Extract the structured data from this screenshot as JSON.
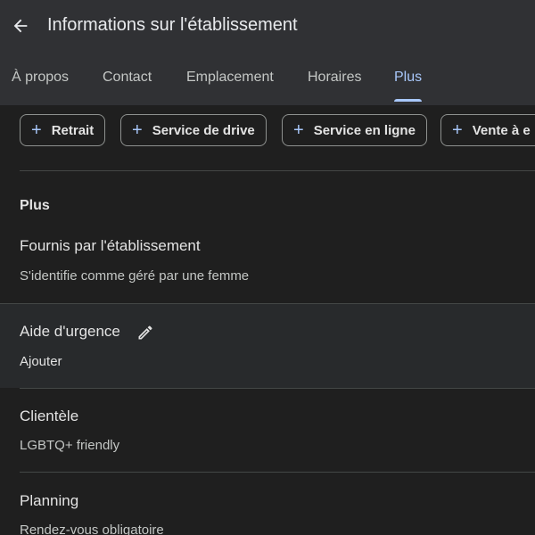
{
  "header": {
    "title": "Informations sur l'établissement",
    "back_icon": "arrow-left-icon"
  },
  "tabs": [
    {
      "label": "À propos",
      "active": false
    },
    {
      "label": "Contact",
      "active": false
    },
    {
      "label": "Emplacement",
      "active": false
    },
    {
      "label": "Horaires",
      "active": false
    },
    {
      "label": "Plus",
      "active": true
    }
  ],
  "chips": [
    {
      "label": "Retrait"
    },
    {
      "label": "Service de drive"
    },
    {
      "label": "Service en ligne"
    },
    {
      "label": "Vente à e"
    }
  ],
  "section": {
    "title": "Plus"
  },
  "rows": [
    {
      "title": "Fournis par l'établissement",
      "value": "S'identifie comme géré par une femme"
    },
    {
      "title": "Aide d'urgence",
      "value": "Ajouter"
    },
    {
      "title": "Clientèle",
      "value": "LGBTQ+ friendly"
    },
    {
      "title": "Planning",
      "value": "Rendez-vous obligatoire"
    }
  ],
  "colors": {
    "accent": "#a8c7fa",
    "background": "#1f1f1f",
    "header": "#303134"
  }
}
